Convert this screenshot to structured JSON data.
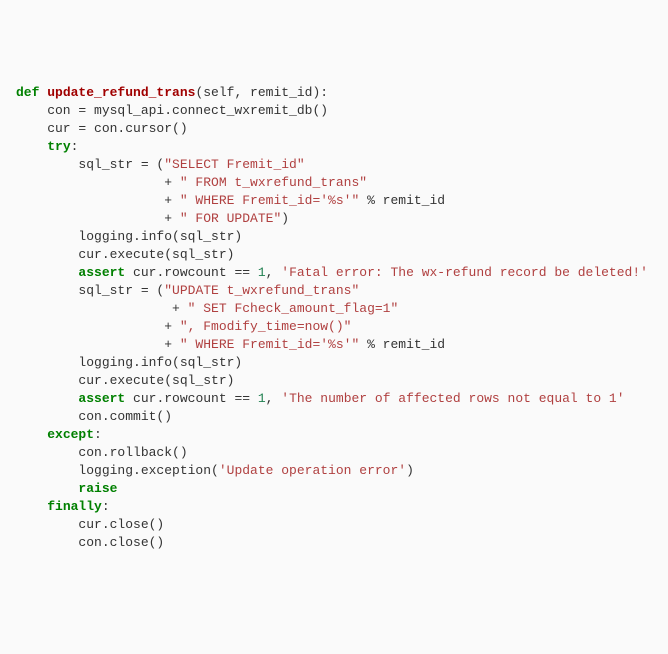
{
  "code": {
    "tokens": [
      [
        [
          "kw",
          "def"
        ],
        [
          "id",
          " "
        ],
        [
          "fn",
          "update_refund_trans"
        ],
        [
          "id",
          "(self, remit_id):"
        ]
      ],
      [
        [
          "id",
          "    con = mysql_api.connect_wxremit_db()"
        ]
      ],
      [
        [
          "id",
          "    cur = con.cursor()"
        ]
      ],
      [
        [
          "id",
          "    "
        ],
        [
          "kw",
          "try"
        ],
        [
          "id",
          ":"
        ]
      ],
      [
        [
          "id",
          "        sql_str = ("
        ],
        [
          "str",
          "\"SELECT Fremit_id\""
        ]
      ],
      [
        [
          "id",
          "                   + "
        ],
        [
          "str",
          "\" FROM t_wxrefund_trans\""
        ]
      ],
      [
        [
          "id",
          "                   + "
        ],
        [
          "str",
          "\" WHERE Fremit_id='%s'\""
        ],
        [
          "id",
          " % remit_id"
        ]
      ],
      [
        [
          "id",
          "                   + "
        ],
        [
          "str",
          "\" FOR UPDATE\""
        ],
        [
          "id",
          ")"
        ]
      ],
      [
        [
          "id",
          "        logging.info(sql_str)"
        ]
      ],
      [
        [
          "id",
          ""
        ]
      ],
      [
        [
          "id",
          "        cur.execute(sql_str)"
        ]
      ],
      [
        [
          "id",
          "        "
        ],
        [
          "kw",
          "assert"
        ],
        [
          "id",
          " cur.rowcount == "
        ],
        [
          "num",
          "1"
        ],
        [
          "id",
          ", "
        ],
        [
          "str",
          "'Fatal error: The wx-refund record be deleted!'"
        ]
      ],
      [
        [
          "id",
          ""
        ]
      ],
      [
        [
          "id",
          "        sql_str = ("
        ],
        [
          "str",
          "\"UPDATE t_wxrefund_trans\""
        ]
      ],
      [
        [
          "id",
          "                    + "
        ],
        [
          "str",
          "\" SET Fcheck_amount_flag=1\""
        ]
      ],
      [
        [
          "id",
          "                   + "
        ],
        [
          "str",
          "\", Fmodify_time=now()\""
        ]
      ],
      [
        [
          "id",
          "                   + "
        ],
        [
          "str",
          "\" WHERE Fremit_id='%s'\""
        ],
        [
          "id",
          " % remit_id"
        ]
      ],
      [
        [
          "id",
          "        logging.info(sql_str)"
        ]
      ],
      [
        [
          "id",
          "        cur.execute(sql_str)"
        ]
      ],
      [
        [
          "id",
          ""
        ]
      ],
      [
        [
          "id",
          "        "
        ],
        [
          "kw",
          "assert"
        ],
        [
          "id",
          " cur.rowcount == "
        ],
        [
          "num",
          "1"
        ],
        [
          "id",
          ", "
        ],
        [
          "str",
          "'The number of affected rows not equal to 1'"
        ]
      ],
      [
        [
          "id",
          "        con.commit()"
        ]
      ],
      [
        [
          "id",
          "    "
        ],
        [
          "kw",
          "except"
        ],
        [
          "id",
          ":"
        ]
      ],
      [
        [
          "id",
          "        con.rollback()"
        ]
      ],
      [
        [
          "id",
          "        logging.exception("
        ],
        [
          "str",
          "'Update operation error'"
        ],
        [
          "id",
          ")"
        ]
      ],
      [
        [
          "id",
          "        "
        ],
        [
          "kw",
          "raise"
        ]
      ],
      [
        [
          "id",
          "    "
        ],
        [
          "kw",
          "finally"
        ],
        [
          "id",
          ":"
        ]
      ],
      [
        [
          "id",
          "        cur.close()"
        ]
      ],
      [
        [
          "id",
          "        con.close()"
        ]
      ]
    ]
  }
}
